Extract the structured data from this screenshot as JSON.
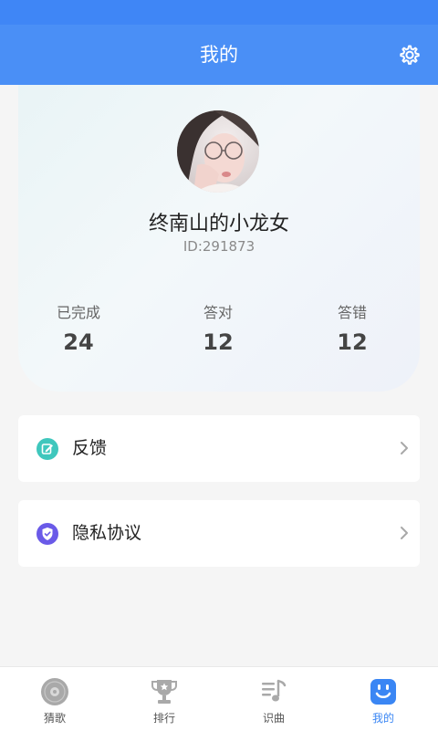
{
  "header": {
    "title": "我的",
    "settings_icon": "gear-icon"
  },
  "profile": {
    "username": "终南山的小龙女",
    "user_id": "ID:291873",
    "stats": [
      {
        "label": "已完成",
        "value": "24"
      },
      {
        "label": "答对",
        "value": "12"
      },
      {
        "label": "答错",
        "value": "12"
      }
    ]
  },
  "menu": {
    "items": [
      {
        "label": "反馈",
        "icon": "edit-icon",
        "icon_color": "#3fc7bd"
      },
      {
        "label": "隐私协议",
        "icon": "shield-check-icon",
        "icon_color": "#6a5ae8"
      }
    ]
  },
  "bottom_nav": {
    "items": [
      {
        "label": "猜歌",
        "icon": "disc-icon"
      },
      {
        "label": "排行",
        "icon": "trophy-icon"
      },
      {
        "label": "识曲",
        "icon": "music-list-icon"
      },
      {
        "label": "我的",
        "icon": "smile-face-icon",
        "active": true
      }
    ]
  },
  "colors": {
    "primary": "#4a8ff6",
    "active_tab": "#3a86f4"
  }
}
